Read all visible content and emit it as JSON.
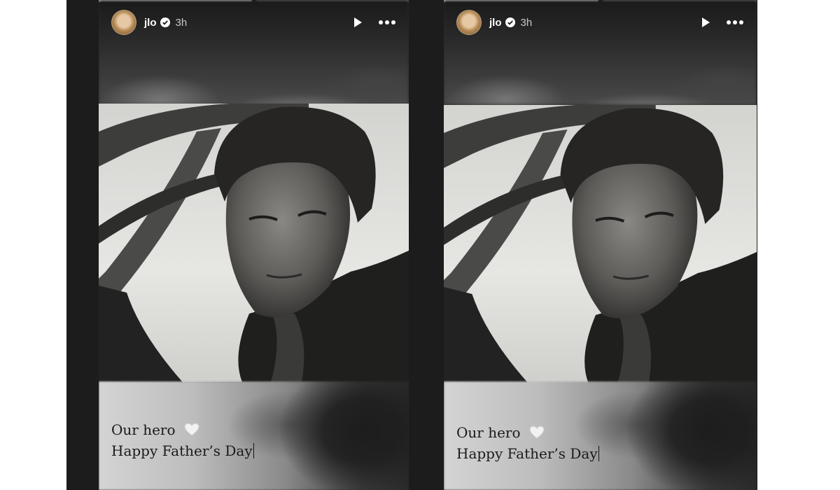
{
  "stories": [
    {
      "username": "jlo",
      "timestamp": "3h",
      "caption_line1": "Our hero",
      "caption_line2": "Happy Father’s Day"
    },
    {
      "username": "jlo",
      "timestamp": "3h",
      "caption_line1": "Our hero",
      "caption_line2": "Happy Father’s Day"
    }
  ],
  "icons": {
    "verified": "verified-badge-icon",
    "play": "play-icon",
    "more": "more-options-icon",
    "heart": "white-heart-emoji"
  },
  "colors": {
    "panel_background": "#1c1c1c",
    "page_background": "#ffffff",
    "text_light": "#ffffff",
    "caption_text": "#1a1a1a"
  }
}
